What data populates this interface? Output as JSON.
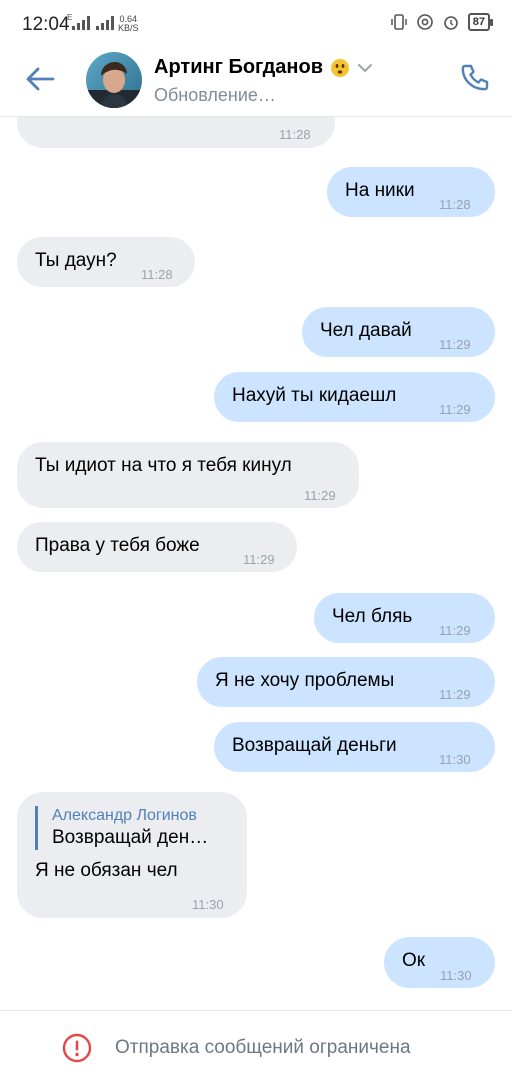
{
  "status_bar": {
    "time": "12:04",
    "network_label": "E",
    "speed_value": "0.64",
    "speed_unit": "KB/S",
    "battery": "87"
  },
  "header": {
    "contact_name": "Артинг Богданов",
    "status": "Обновление…"
  },
  "messages": [
    {
      "direction": "in",
      "text": "",
      "time": "11:28"
    },
    {
      "direction": "out",
      "text": "На ники",
      "time": "11:28"
    },
    {
      "direction": "in",
      "text": "Ты даун?",
      "time": "11:28"
    },
    {
      "direction": "out",
      "text": "Чел давай",
      "time": "11:29"
    },
    {
      "direction": "out",
      "text": "Нахуй ты кидаешл",
      "time": "11:29"
    },
    {
      "direction": "in",
      "text": "Ты идиот на что я тебя кинул",
      "time": "11:29"
    },
    {
      "direction": "in",
      "text": "Права у тебя боже",
      "time": "11:29"
    },
    {
      "direction": "out",
      "text": "Чел бляь",
      "time": "11:29"
    },
    {
      "direction": "out",
      "text": "Я не хочу проблемы",
      "time": "11:29"
    },
    {
      "direction": "out",
      "text": "Возвращай деньги",
      "time": "11:30"
    },
    {
      "direction": "in",
      "reply_author": "Александр Логинов",
      "reply_text": "Возвращай ден…",
      "text": "Я не обязан чел",
      "time": "11:30"
    },
    {
      "direction": "out",
      "text": "Ок",
      "time": "11:30"
    }
  ],
  "bottom_bar": {
    "notice": "Отправка сообщений ограничена"
  },
  "colors": {
    "accent": "#5181b8",
    "incoming_bubble": "#ebedf0",
    "outgoing_bubble": "#cce4ff",
    "error": "#e64646"
  },
  "icons": {
    "back": "back-arrow-icon",
    "call": "phone-icon",
    "status": "emoji-icon",
    "chevron": "chevron-down-icon",
    "restriction": "exclamation-circle-icon"
  }
}
